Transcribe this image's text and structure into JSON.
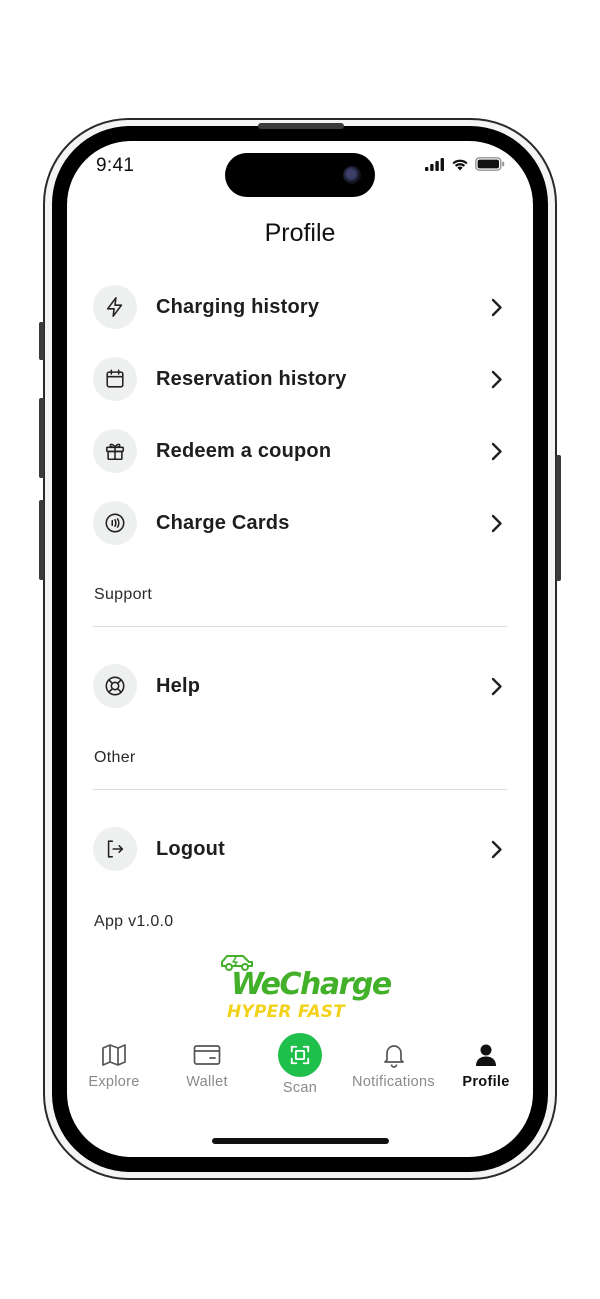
{
  "status_bar": {
    "time": "9:41"
  },
  "header": {
    "title": "Profile"
  },
  "menu": {
    "items": [
      {
        "label": "Charging history",
        "icon": "lightning-icon"
      },
      {
        "label": "Reservation history",
        "icon": "calendar-icon"
      },
      {
        "label": "Redeem a coupon",
        "icon": "gift-icon"
      },
      {
        "label": "Charge Cards",
        "icon": "nfc-card-icon"
      }
    ]
  },
  "support": {
    "label": "Support",
    "items": [
      {
        "label": "Help",
        "icon": "lifebuoy-icon"
      }
    ]
  },
  "other": {
    "label": "Other",
    "items": [
      {
        "label": "Logout",
        "icon": "logout-icon"
      }
    ]
  },
  "version": "App v1.0.0",
  "logo": {
    "main": "WeCharge",
    "sub": "HYPER FAST"
  },
  "colors": {
    "brand_green": "#43b02a",
    "brand_yellow": "#f2d21b",
    "scan_green": "#1fbf4c"
  },
  "tabbar": {
    "tabs": [
      {
        "label": "Explore",
        "icon": "map-icon"
      },
      {
        "label": "Wallet",
        "icon": "wallet-icon"
      },
      {
        "label": "Scan",
        "icon": "scan-icon"
      },
      {
        "label": "Notifications",
        "icon": "bell-icon"
      },
      {
        "label": "Profile",
        "icon": "person-icon",
        "active": true
      }
    ]
  }
}
